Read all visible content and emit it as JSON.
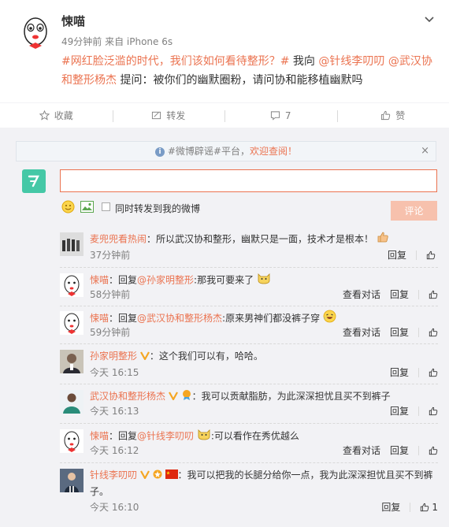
{
  "post": {
    "author": "悚喵",
    "meta": "49分钟前 来自 iPhone 6s",
    "topic": "#网红脸泛滥的时代，我们该如何看待整形？#",
    "text_mid": " 我向 ",
    "mention1": "@针线李叨叨",
    "mention2": "@武汉协和整形杨杰",
    "text_end": " 提问：被你们的幽默圈粉，请问协和能移植幽默吗",
    "collapse_icon": "chevron-down-icon"
  },
  "actions": [
    {
      "label": "收藏",
      "icon": "star-icon"
    },
    {
      "label": "转发",
      "icon": "repost-icon"
    },
    {
      "label": "7",
      "icon": "comment-icon"
    },
    {
      "label": "赞",
      "icon": "thumb-up-icon"
    }
  ],
  "notice": {
    "prefix": "#微博辟谣#",
    "mid": "平台，",
    "link": "欢迎查阅！",
    "close": "×"
  },
  "composer": {
    "input_value": "",
    "also_forward_label": "同时转发到我的微博",
    "submit_label": "评论"
  },
  "comments": [
    {
      "user": "麦兜兜看热闹",
      "text": "：所以武汉协和整形，幽默只是一面，技术才是根本！",
      "time": "37分钟前",
      "ops": [
        "回复"
      ],
      "like_count": ""
    },
    {
      "user": "悚喵",
      "reply_prefix": "：回复",
      "at": "@孙家明整形",
      "text": ":那我可要来了",
      "time": "58分钟前",
      "ops": [
        "查看对话",
        "回复"
      ],
      "like_count": ""
    },
    {
      "user": "悚喵",
      "reply_prefix": "：回复",
      "at": "@武汉协和整形杨杰",
      "text": ":原来男神们都没裤子穿",
      "time": "59分钟前",
      "ops": [
        "查看对话",
        "回复"
      ],
      "like_count": ""
    },
    {
      "user": "孙家明整形",
      "text": "：这个我们可以有，哈哈。",
      "time": "今天 16:15",
      "ops": [
        "回复"
      ],
      "like_count": ""
    },
    {
      "user": "武汉协和整形杨杰",
      "text": "：我可以贡献脂肪，为此深深担忧且买不到裤子",
      "time": "今天 16:13",
      "ops": [
        "回复"
      ],
      "like_count": ""
    },
    {
      "user": "悚喵",
      "reply_prefix": "：回复",
      "at": "@针线李叨叨",
      "text": ":可以看作在秀优越么",
      "time": "今天 16:12",
      "ops": [
        "查看对话",
        "回复"
      ],
      "like_count": ""
    },
    {
      "user": "针线李叨叨",
      "text": "：我可以把我的长腿分给你一点，我为此深深担忧且买不到裤子。",
      "time": "今天 16:10",
      "ops": [
        "回复"
      ],
      "like_count": "1"
    }
  ],
  "colors": {
    "accent": "#eb7350",
    "muted": "#808080",
    "panel": "#f2f2f5"
  }
}
